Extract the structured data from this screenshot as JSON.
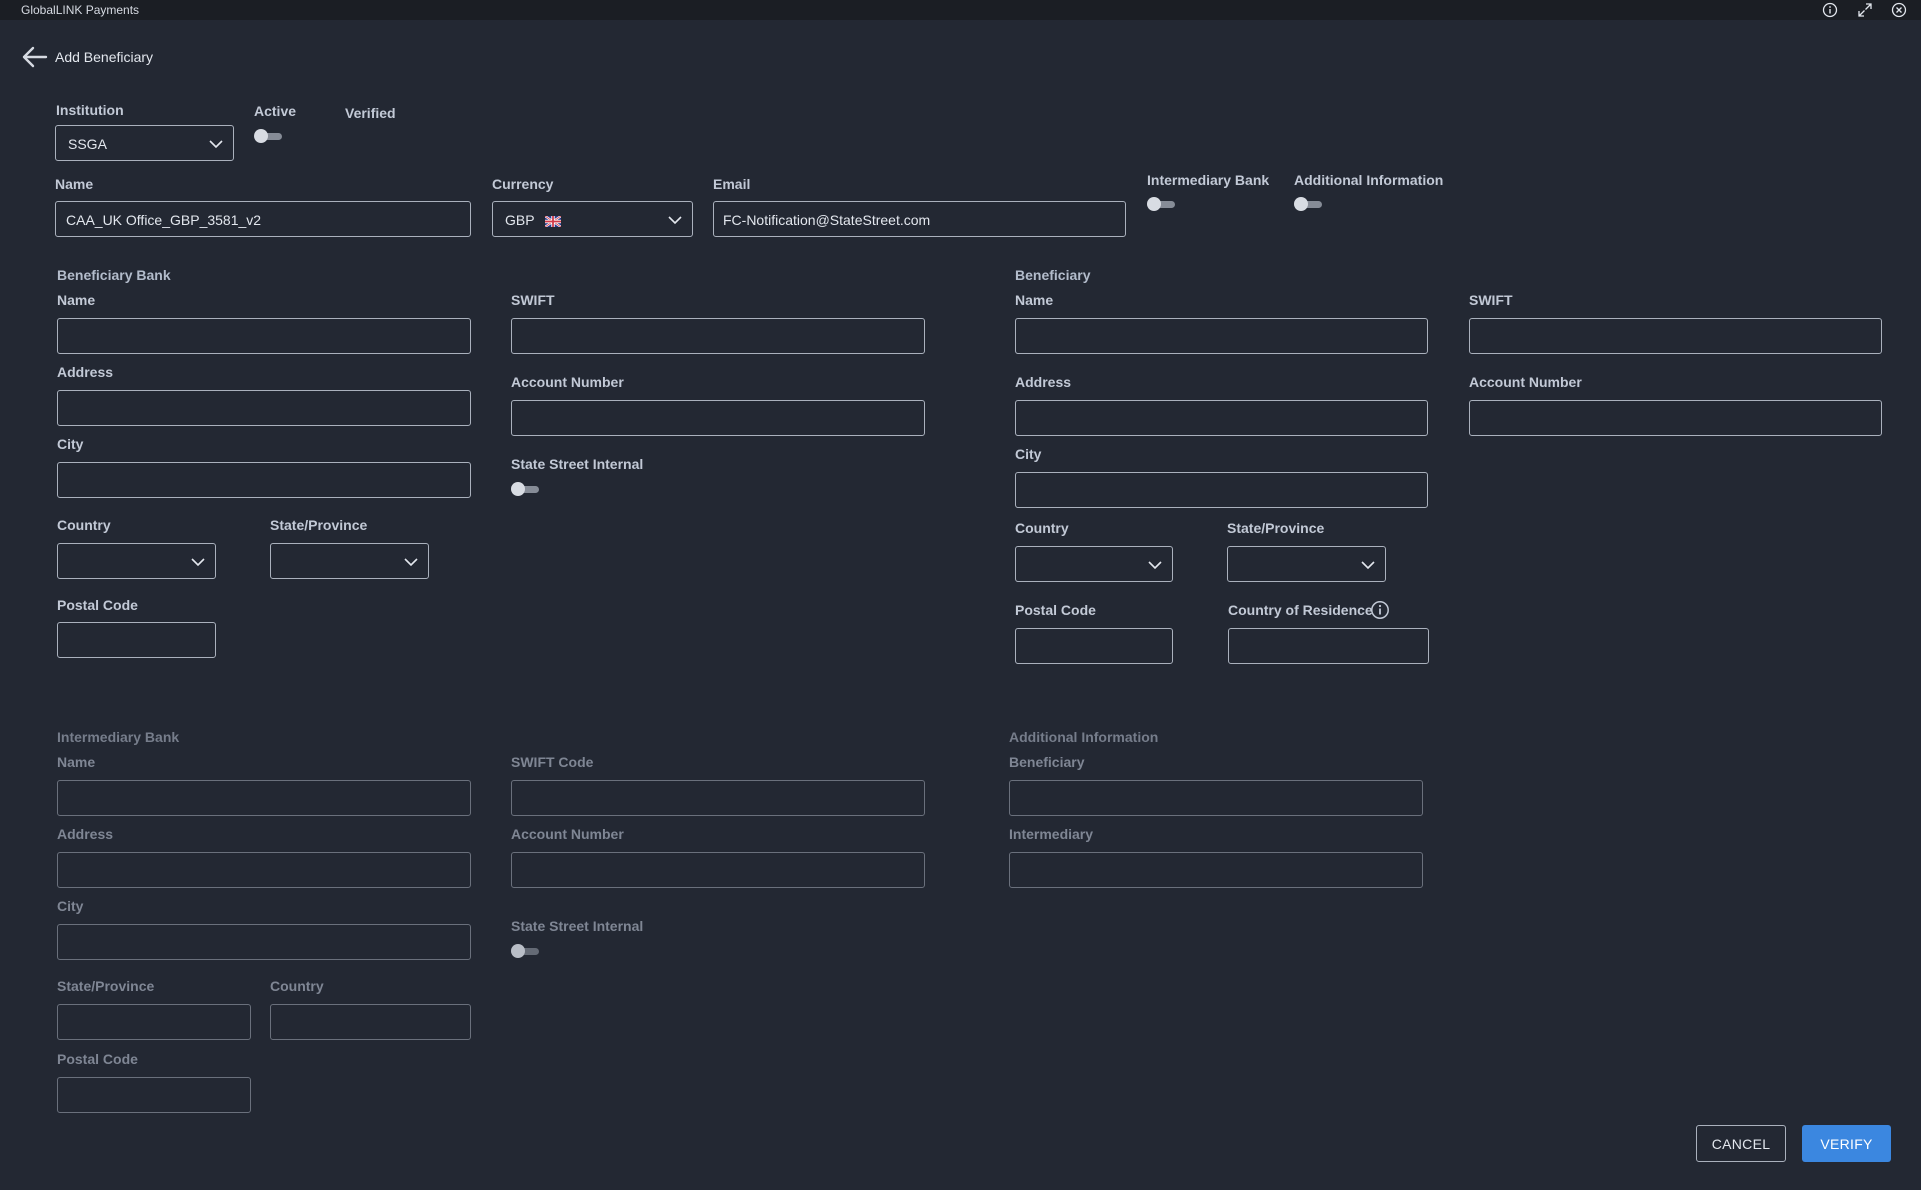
{
  "app": {
    "title": "GlobalLINK Payments"
  },
  "page": {
    "title": "Add Beneficiary"
  },
  "icons": {
    "back": "arrow-left-icon",
    "info": "info-icon",
    "expand": "expand-icon",
    "close": "close-icon",
    "chevron": "chevron-down-icon",
    "flag": "uk-flag-icon"
  },
  "colors": {
    "background": "#232833",
    "titlebar": "#1b1e24",
    "primary": "#3b87e0"
  },
  "header": {
    "institution": {
      "label": "Institution",
      "value": "SSGA"
    },
    "active": {
      "label": "Active",
      "on": false
    },
    "verified": {
      "label": "Verified"
    },
    "name": {
      "label": "Name",
      "value": "CAA_UK Office_GBP_3581_v2"
    },
    "currency": {
      "label": "Currency",
      "value": "GBP"
    },
    "email": {
      "label": "Email",
      "value": "FC-Notification@StateStreet.com"
    },
    "intermediary_toggle": {
      "label": "Intermediary Bank",
      "on": false
    },
    "additional_toggle": {
      "label": "Additional Information",
      "on": false
    }
  },
  "beneficiary_bank": {
    "heading": "Beneficiary Bank",
    "name_label": "Name",
    "address_label": "Address",
    "city_label": "City",
    "country_label": "Country",
    "state_label": "State/Province",
    "postal_label": "Postal Code",
    "swift_label": "SWIFT",
    "account_label": "Account Number",
    "internal_label": "State Street Internal",
    "internal_on": false
  },
  "beneficiary": {
    "heading": "Beneficiary",
    "name_label": "Name",
    "swift_label": "SWIFT",
    "address_label": "Address",
    "account_label": "Account Number",
    "city_label": "City",
    "country_label": "Country",
    "state_label": "State/Province",
    "postal_label": "Postal Code",
    "residence_label": "Country of Residence"
  },
  "intermediary_bank": {
    "heading": "Intermediary Bank",
    "name_label": "Name",
    "swift_label": "SWIFT Code",
    "address_label": "Address",
    "account_label": "Account Number",
    "city_label": "City",
    "internal_label": "State Street Internal",
    "internal_on": false,
    "state_label": "State/Province",
    "country_label": "Country",
    "postal_label": "Postal Code"
  },
  "additional_info": {
    "heading": "Additional Information",
    "beneficiary_label": "Beneficiary",
    "intermediary_label": "Intermediary"
  },
  "actions": {
    "cancel": "CANCEL",
    "verify": "VERIFY"
  }
}
